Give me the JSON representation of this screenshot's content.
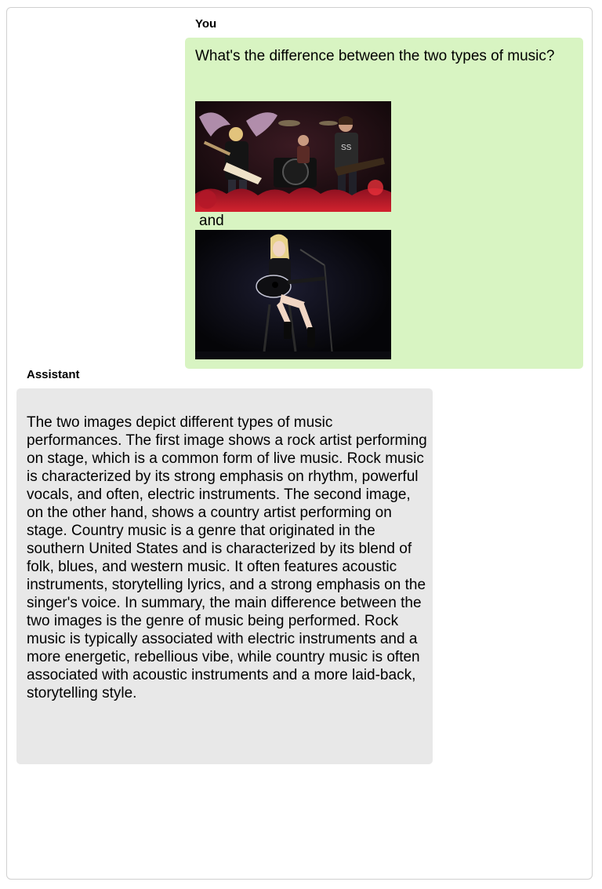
{
  "conversation": {
    "user": {
      "speaker_label": "You",
      "question": "What's the difference between the two types of music?",
      "connector": "and",
      "images": [
        {
          "icon": "rock-concert-photo"
        },
        {
          "icon": "country-concert-photo"
        }
      ]
    },
    "assistant": {
      "speaker_label": "Assistant",
      "response": "The two images depict different types of music performances. The first image shows a rock artist performing on stage, which is a common form of live music. Rock music is characterized by its strong emphasis on rhythm, powerful vocals, and often, electric instruments. The second image, on the other hand, shows a country artist performing on stage. Country music is a genre that originated in the southern United States and is characterized by its blend of folk, blues, and western music. It often features acoustic instruments, storytelling lyrics, and a strong emphasis on the singer's voice. In summary, the main difference between the two images is the genre of music being performed. Rock music is typically associated with electric instruments and a more energetic, rebellious vibe, while country music is often associated with acoustic instruments and a more laid-back, storytelling style."
    }
  },
  "colors": {
    "user_bubble": "#d8f4c2",
    "assistant_bubble": "#e8e8e8",
    "frame_border": "#d0d0d0"
  }
}
